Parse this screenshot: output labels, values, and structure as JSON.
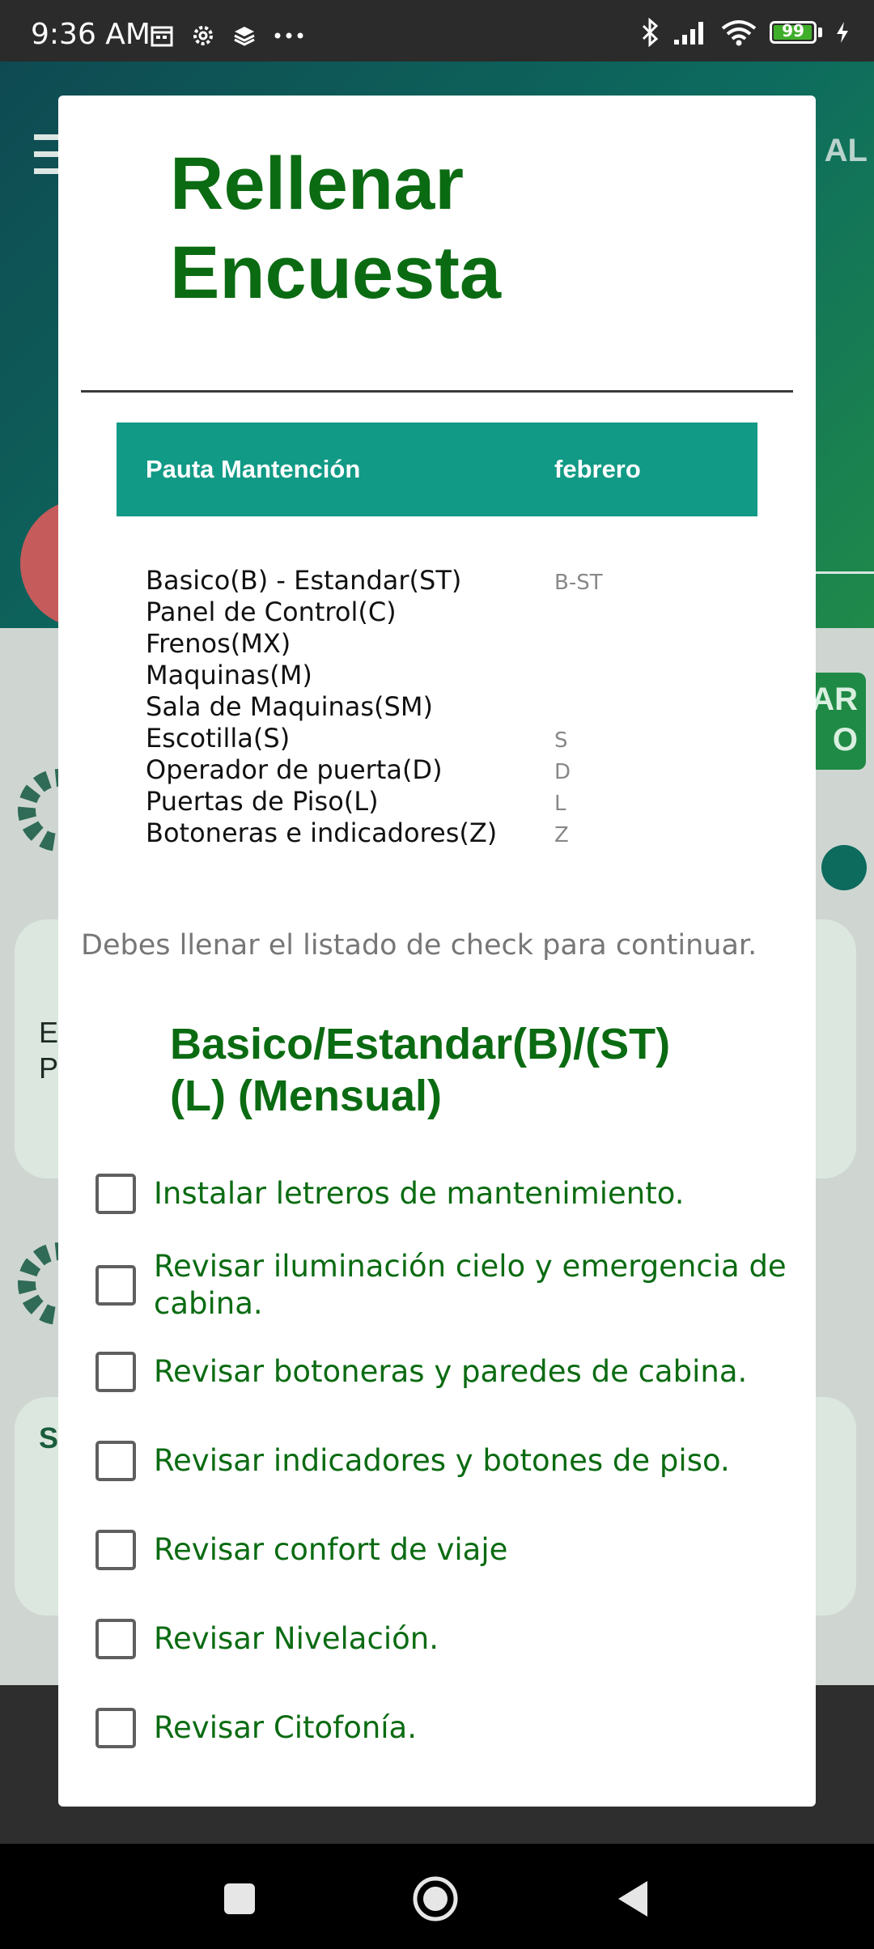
{
  "status_bar": {
    "time": "9:36 AM",
    "battery": "99",
    "battery_level": 0.99,
    "left_icons": [
      "calendar-icon",
      "settings-icon",
      "layers-icon",
      "more-icon"
    ],
    "right_icons": [
      "bluetooth-icon",
      "signal-icon",
      "wifi-icon",
      "battery-icon",
      "charging-icon"
    ]
  },
  "background": {
    "logo_fragment": "AL",
    "button_fragment": "AR\nO",
    "card_text_1": "ED\nP",
    "card_text_2": "S"
  },
  "dialog": {
    "title": "Rellenar Encuesta",
    "table": {
      "col1": "Pauta Mantención",
      "col2": "febrero",
      "rows": [
        {
          "label": "Basico(B) - Estandar(ST)",
          "code": "B-ST"
        },
        {
          "label": "Panel de Control(C)",
          "code": ""
        },
        {
          "label": "Frenos(MX)",
          "code": ""
        },
        {
          "label": "Maquinas(M)",
          "code": ""
        },
        {
          "label": "Sala de Maquinas(SM)",
          "code": ""
        },
        {
          "label": "Escotilla(S)",
          "code": "S"
        },
        {
          "label": "Operador de puerta(D)",
          "code": "D"
        },
        {
          "label": "Puertas de Piso(L)",
          "code": "L"
        },
        {
          "label": "Botoneras e indicadores(Z)",
          "code": "Z"
        }
      ]
    },
    "notice": "Debes llenar el listado de check para continuar.",
    "section_title": "Basico/Estandar(B)/(ST)\n(L) (Mensual)",
    "checklist": [
      {
        "label": "Instalar letreros de mantenimiento.",
        "checked": false
      },
      {
        "label": "Revisar iluminación cielo y emergencia de cabina.",
        "checked": false
      },
      {
        "label": "Revisar botoneras y paredes de cabina.",
        "checked": false
      },
      {
        "label": "Revisar indicadores y botones de piso.",
        "checked": false
      },
      {
        "label": "Revisar confort de viaje",
        "checked": false
      },
      {
        "label": "Revisar Nivelación.",
        "checked": false
      },
      {
        "label": "Revisar Citofonía.",
        "checked": false
      }
    ]
  },
  "nav_bar": {
    "buttons": [
      "recents-button",
      "home-button",
      "back-button"
    ]
  },
  "colors": {
    "accent_green": "#0b6b12",
    "table_header": "#119a86",
    "status_bar": "#2b2b2b"
  }
}
